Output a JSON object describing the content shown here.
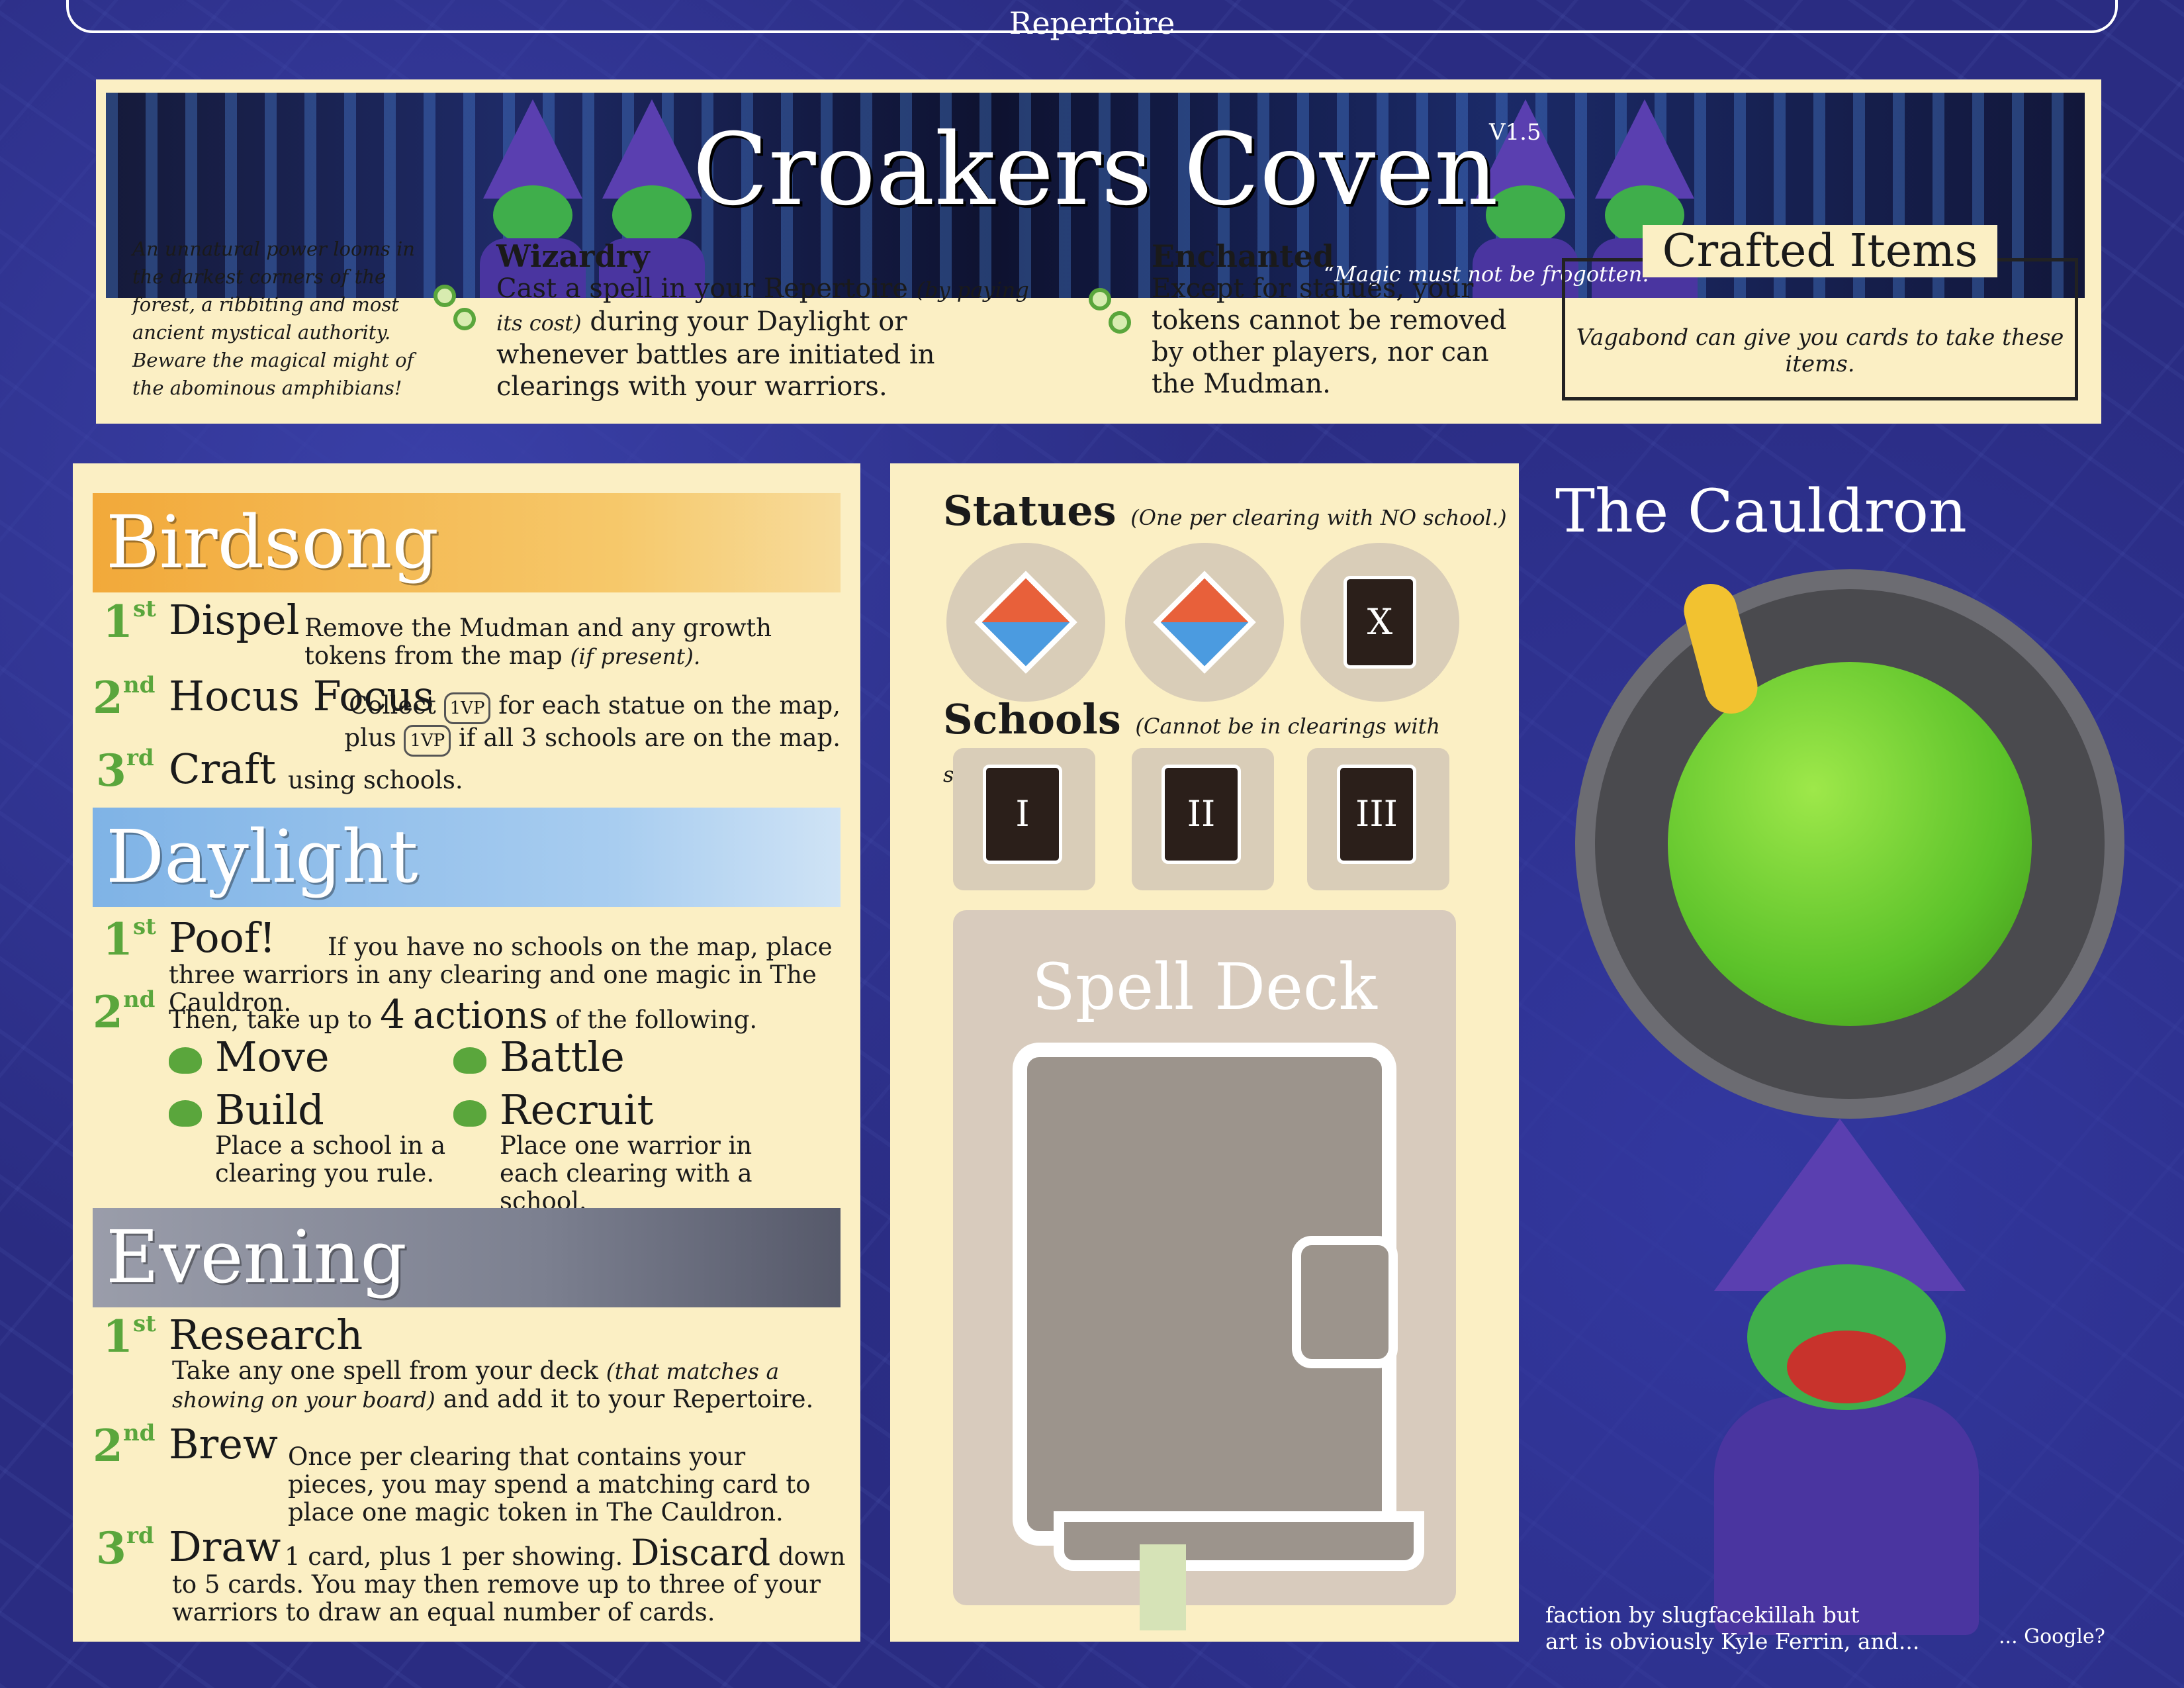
{
  "tab": {
    "label": "Repertoire"
  },
  "header": {
    "title": "Croakers Coven",
    "version": "V1.5",
    "quote": "“Magic must not be frogotten.”",
    "lore": "An unnatural power looms in the darkest corners of the forest, a ribbiting and most ancient mystical authority. Beware the magical might of the abominous amphibians!",
    "wizardry": {
      "title": "Wizardry",
      "text_a": "Cast a spell in your Repertoire",
      "text_note": "(by paying its cost)",
      "text_b": "during your Daylight or whenever battles are initiated in clearings with your warriors."
    },
    "enchanted": {
      "title": "Enchanted",
      "text": "Except for statues, your tokens cannot be removed by other players, nor can the Mudman."
    },
    "crafted": {
      "title": "Crafted Items",
      "text": "Vagabond can give you cards to take these items."
    }
  },
  "birdsong": {
    "title": "Birdsong",
    "steps": [
      {
        "ord": "1",
        "sup": "st",
        "name": "Dispel",
        "text": "Remove the Mudman and any growth tokens from the map",
        "note": "(if present)."
      },
      {
        "ord": "2",
        "sup": "nd",
        "name": "Hocus Focus",
        "text_a": "Collect",
        "vp": "1VP",
        "text_b": "for each statue on the map, plus",
        "text_c": "if all 3 schools are on the map."
      },
      {
        "ord": "3",
        "sup": "rd",
        "name": "Craft",
        "text": "using schools."
      }
    ]
  },
  "daylight": {
    "title": "Daylight",
    "step1": {
      "ord": "1",
      "sup": "st",
      "name": "Poof!",
      "text": "If you have no schools on the map, place three warriors in any clearing and one magic in The Cauldron."
    },
    "step2": {
      "ord": "2",
      "sup": "nd",
      "lead": "Then, take up to",
      "count": "4",
      "actions_word": "actions",
      "trail": "of the following."
    },
    "actions": [
      {
        "name": "Move",
        "desc": ""
      },
      {
        "name": "Battle",
        "desc": ""
      },
      {
        "name": "Build",
        "desc": "Place a school in a clearing you rule."
      },
      {
        "name": "Recruit",
        "desc": "Place one warrior in each clearing with a school."
      }
    ]
  },
  "evening": {
    "title": "Evening",
    "research": {
      "ord": "1",
      "sup": "st",
      "name": "Research",
      "text_a": "Take any one spell from your deck",
      "note": "(that matches a showing on your board)",
      "text_b": "and add it to your Repertoire."
    },
    "brew": {
      "ord": "2",
      "sup": "nd",
      "name": "Brew",
      "text": "Once per clearing that contains your pieces, you may spend a matching card to place one magic token in The Cauldron."
    },
    "draw": {
      "ord": "3",
      "sup": "rd",
      "name": "Draw",
      "text_a": "1 card, plus 1 per",
      "text_b": "showing.",
      "discard": "Discard",
      "text_c": "down to 5 cards. You may then remove up to three of your warriors to draw an equal number of cards."
    }
  },
  "statues": {
    "title": "Statues",
    "note": "(One per clearing with NO school.)",
    "x_label": "X"
  },
  "schools": {
    "title": "Schools",
    "note": "(Cannot be in clearings with statues.)",
    "labels": [
      "I",
      "II",
      "III"
    ]
  },
  "spell_deck": {
    "title": "Spell Deck"
  },
  "cauldron": {
    "title": "The Cauldron"
  },
  "credit": {
    "line1": "faction by slugfacekillah but",
    "line2": "art is obviously Kyle Ferrin, and...",
    "line3": "... Google?"
  },
  "colors": {
    "birdsong": "#f2a93a",
    "daylight": "#8fbde8",
    "evening": "#8b8f9c",
    "accent_green": "#5aa63c",
    "parchment": "#fbefc4"
  }
}
